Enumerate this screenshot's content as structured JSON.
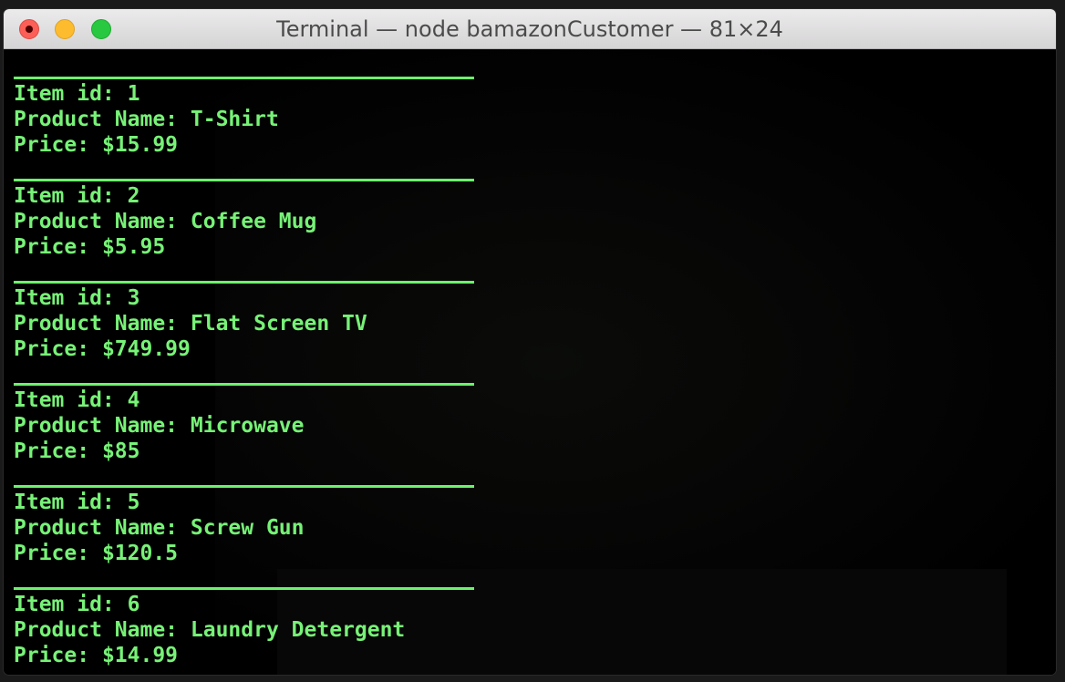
{
  "window": {
    "title": "Terminal — node bamazonCustomer — 81×24"
  },
  "colors": {
    "terminal_background": "#000000",
    "terminal_text": "#77f277",
    "separator": "#6df26d"
  },
  "labels": {
    "item_id": "Item id: ",
    "product_name": "Product Name: ",
    "price": "Price: "
  },
  "items": [
    {
      "id": "1",
      "name": "T-Shirt",
      "price": "$15.99"
    },
    {
      "id": "2",
      "name": "Coffee Mug",
      "price": "$5.95"
    },
    {
      "id": "3",
      "name": "Flat Screen TV",
      "price": "$749.99"
    },
    {
      "id": "4",
      "name": "Microwave",
      "price": "$85"
    },
    {
      "id": "5",
      "name": "Screw Gun",
      "price": "$120.5"
    },
    {
      "id": "6",
      "name": "Laundry Detergent",
      "price": "$14.99"
    }
  ]
}
